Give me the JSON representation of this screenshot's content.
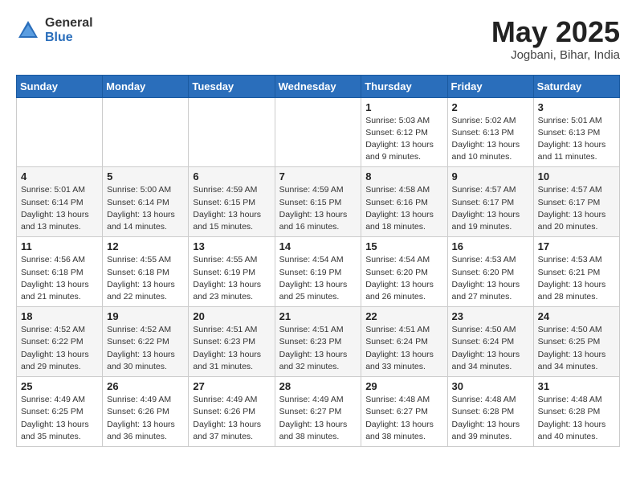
{
  "header": {
    "logo_general": "General",
    "logo_blue": "Blue",
    "month_title": "May 2025",
    "location": "Jogbani, Bihar, India"
  },
  "weekdays": [
    "Sunday",
    "Monday",
    "Tuesday",
    "Wednesday",
    "Thursday",
    "Friday",
    "Saturday"
  ],
  "weeks": [
    [
      {
        "day": "",
        "info": ""
      },
      {
        "day": "",
        "info": ""
      },
      {
        "day": "",
        "info": ""
      },
      {
        "day": "",
        "info": ""
      },
      {
        "day": "1",
        "info": "Sunrise: 5:03 AM\nSunset: 6:12 PM\nDaylight: 13 hours\nand 9 minutes."
      },
      {
        "day": "2",
        "info": "Sunrise: 5:02 AM\nSunset: 6:13 PM\nDaylight: 13 hours\nand 10 minutes."
      },
      {
        "day": "3",
        "info": "Sunrise: 5:01 AM\nSunset: 6:13 PM\nDaylight: 13 hours\nand 11 minutes."
      }
    ],
    [
      {
        "day": "4",
        "info": "Sunrise: 5:01 AM\nSunset: 6:14 PM\nDaylight: 13 hours\nand 13 minutes."
      },
      {
        "day": "5",
        "info": "Sunrise: 5:00 AM\nSunset: 6:14 PM\nDaylight: 13 hours\nand 14 minutes."
      },
      {
        "day": "6",
        "info": "Sunrise: 4:59 AM\nSunset: 6:15 PM\nDaylight: 13 hours\nand 15 minutes."
      },
      {
        "day": "7",
        "info": "Sunrise: 4:59 AM\nSunset: 6:15 PM\nDaylight: 13 hours\nand 16 minutes."
      },
      {
        "day": "8",
        "info": "Sunrise: 4:58 AM\nSunset: 6:16 PM\nDaylight: 13 hours\nand 18 minutes."
      },
      {
        "day": "9",
        "info": "Sunrise: 4:57 AM\nSunset: 6:17 PM\nDaylight: 13 hours\nand 19 minutes."
      },
      {
        "day": "10",
        "info": "Sunrise: 4:57 AM\nSunset: 6:17 PM\nDaylight: 13 hours\nand 20 minutes."
      }
    ],
    [
      {
        "day": "11",
        "info": "Sunrise: 4:56 AM\nSunset: 6:18 PM\nDaylight: 13 hours\nand 21 minutes."
      },
      {
        "day": "12",
        "info": "Sunrise: 4:55 AM\nSunset: 6:18 PM\nDaylight: 13 hours\nand 22 minutes."
      },
      {
        "day": "13",
        "info": "Sunrise: 4:55 AM\nSunset: 6:19 PM\nDaylight: 13 hours\nand 23 minutes."
      },
      {
        "day": "14",
        "info": "Sunrise: 4:54 AM\nSunset: 6:19 PM\nDaylight: 13 hours\nand 25 minutes."
      },
      {
        "day": "15",
        "info": "Sunrise: 4:54 AM\nSunset: 6:20 PM\nDaylight: 13 hours\nand 26 minutes."
      },
      {
        "day": "16",
        "info": "Sunrise: 4:53 AM\nSunset: 6:20 PM\nDaylight: 13 hours\nand 27 minutes."
      },
      {
        "day": "17",
        "info": "Sunrise: 4:53 AM\nSunset: 6:21 PM\nDaylight: 13 hours\nand 28 minutes."
      }
    ],
    [
      {
        "day": "18",
        "info": "Sunrise: 4:52 AM\nSunset: 6:22 PM\nDaylight: 13 hours\nand 29 minutes."
      },
      {
        "day": "19",
        "info": "Sunrise: 4:52 AM\nSunset: 6:22 PM\nDaylight: 13 hours\nand 30 minutes."
      },
      {
        "day": "20",
        "info": "Sunrise: 4:51 AM\nSunset: 6:23 PM\nDaylight: 13 hours\nand 31 minutes."
      },
      {
        "day": "21",
        "info": "Sunrise: 4:51 AM\nSunset: 6:23 PM\nDaylight: 13 hours\nand 32 minutes."
      },
      {
        "day": "22",
        "info": "Sunrise: 4:51 AM\nSunset: 6:24 PM\nDaylight: 13 hours\nand 33 minutes."
      },
      {
        "day": "23",
        "info": "Sunrise: 4:50 AM\nSunset: 6:24 PM\nDaylight: 13 hours\nand 34 minutes."
      },
      {
        "day": "24",
        "info": "Sunrise: 4:50 AM\nSunset: 6:25 PM\nDaylight: 13 hours\nand 34 minutes."
      }
    ],
    [
      {
        "day": "25",
        "info": "Sunrise: 4:49 AM\nSunset: 6:25 PM\nDaylight: 13 hours\nand 35 minutes."
      },
      {
        "day": "26",
        "info": "Sunrise: 4:49 AM\nSunset: 6:26 PM\nDaylight: 13 hours\nand 36 minutes."
      },
      {
        "day": "27",
        "info": "Sunrise: 4:49 AM\nSunset: 6:26 PM\nDaylight: 13 hours\nand 37 minutes."
      },
      {
        "day": "28",
        "info": "Sunrise: 4:49 AM\nSunset: 6:27 PM\nDaylight: 13 hours\nand 38 minutes."
      },
      {
        "day": "29",
        "info": "Sunrise: 4:48 AM\nSunset: 6:27 PM\nDaylight: 13 hours\nand 38 minutes."
      },
      {
        "day": "30",
        "info": "Sunrise: 4:48 AM\nSunset: 6:28 PM\nDaylight: 13 hours\nand 39 minutes."
      },
      {
        "day": "31",
        "info": "Sunrise: 4:48 AM\nSunset: 6:28 PM\nDaylight: 13 hours\nand 40 minutes."
      }
    ]
  ]
}
